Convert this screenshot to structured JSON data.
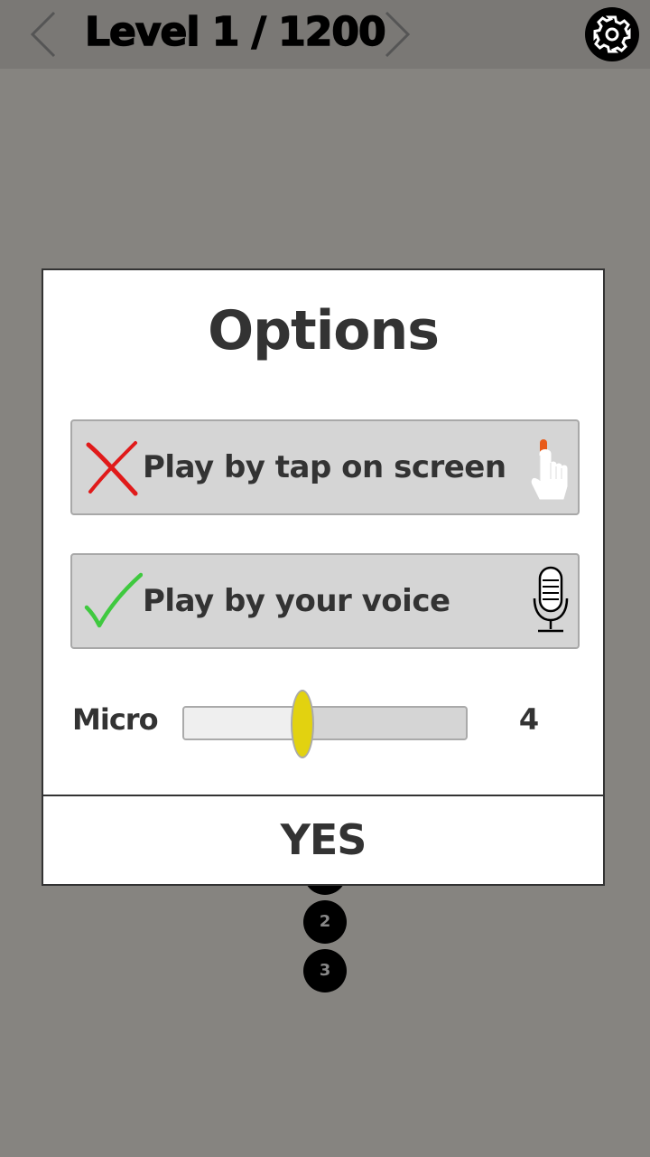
{
  "header": {
    "level_title": "Level 1 / 1200",
    "prev_icon": "chevron-left-icon",
    "next_icon": "chevron-right-icon",
    "settings_icon": "gear-icon"
  },
  "levels": [
    "",
    "2",
    "3"
  ],
  "dialog": {
    "title": "Options",
    "options": [
      {
        "label": "Play by tap on screen",
        "status": "off",
        "status_icon": "cross-icon",
        "icon": "tap-hand-icon"
      },
      {
        "label": "Play by your voice",
        "status": "on",
        "status_icon": "check-icon",
        "icon": "microphone-icon"
      }
    ],
    "micro": {
      "label": "Micro",
      "value": "4",
      "slider_fraction": 0.42,
      "knob_color": "#e2d210"
    },
    "confirm_label": "YES"
  },
  "colors": {
    "cross": "#e01a1a",
    "check": "#3fc93f",
    "tap_finger": "#e85a1a"
  }
}
